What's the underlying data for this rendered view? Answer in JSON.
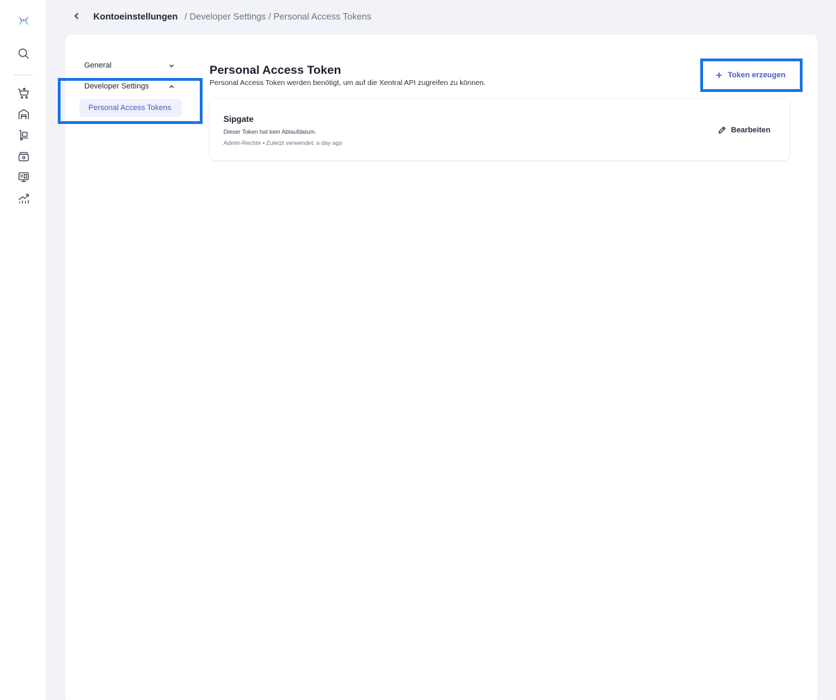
{
  "breadcrumb": {
    "root": "Kontoeinstellungen",
    "rest": "/ Developer Settings / Personal Access Tokens"
  },
  "settings_nav": {
    "general_label": "General",
    "developer_label": "Developer Settings",
    "active_subitem": "Personal Access Tokens"
  },
  "page": {
    "title": "Personal Access Token",
    "subtitle": "Personal Access Token werden benötigt, um auf die Xentral API zugreifen zu können.",
    "create_button_label": "Token erzeugen"
  },
  "tokens": [
    {
      "name": "Sipgate",
      "expiry": "Dieser Token hat kein Ablaufdatum.",
      "meta": "Admin-Rechte • Zuletzt verwendet: a day ago",
      "edit_label": "Bearbeiten"
    }
  ],
  "rail_icons": [
    "xentral-logo-icon",
    "search-icon",
    "cart-icon",
    "warehouse-icon",
    "trolley-icon",
    "cash-register-icon",
    "pos-terminal-icon",
    "chart-icon"
  ],
  "colors": {
    "accent": "#4f5bc4",
    "highlight": "#1a73e8",
    "background": "#f1f3f8",
    "active_nav_bg": "#eef0fb"
  }
}
